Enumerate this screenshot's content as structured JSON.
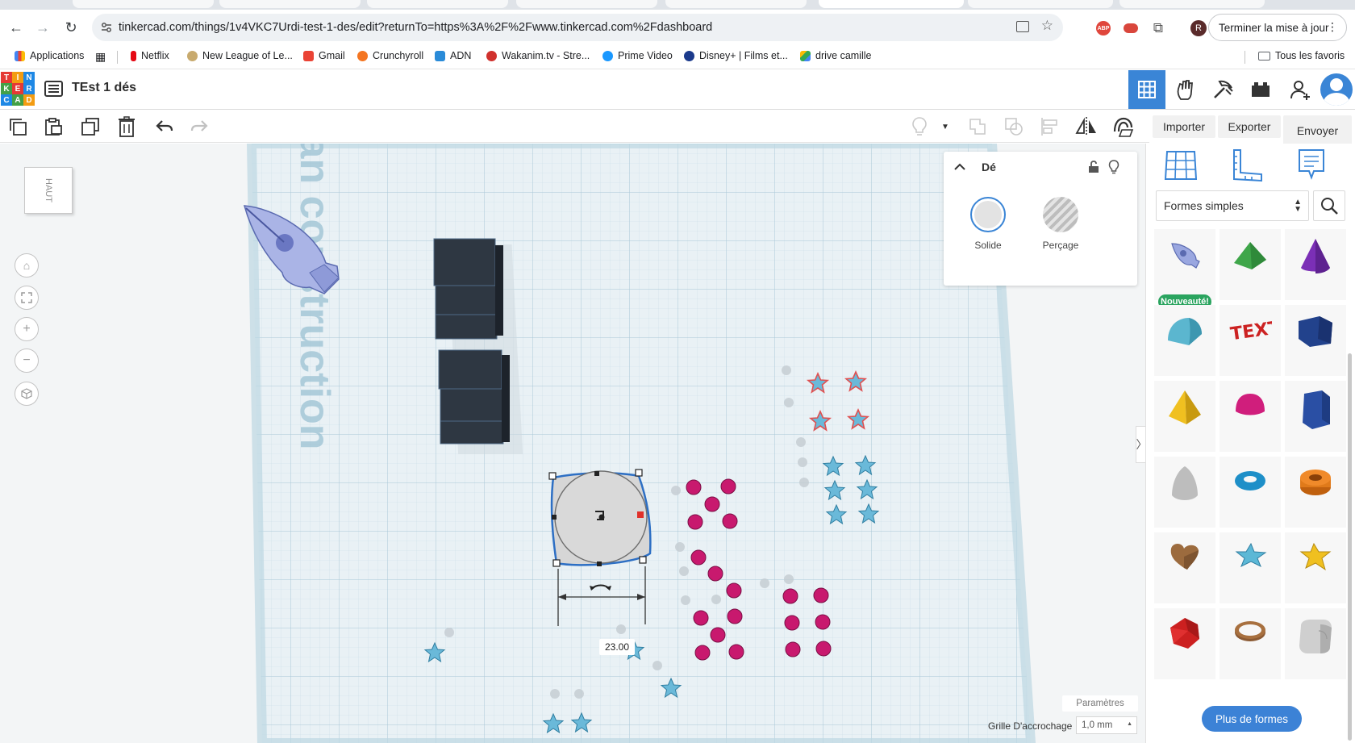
{
  "browser": {
    "url": "tinkercad.com/things/1v4VKC7Urdi-test-1-des/edit?returnTo=https%3A%2F%2Fwww.tinkercad.com%2Fdashboard",
    "update_button": "Terminer la mise à jour",
    "profile_letter": "R",
    "bookmarks": [
      {
        "label": "Applications",
        "color": "#4285f4"
      },
      {
        "label": "Netflix",
        "color": "#e50914"
      },
      {
        "label": "New League of Le...",
        "color": "#c8aa6e"
      },
      {
        "label": "Gmail",
        "color": "#ea4335"
      },
      {
        "label": "Crunchyroll",
        "color": "#f47521"
      },
      {
        "label": "ADN",
        "color": "#2a8bd8"
      },
      {
        "label": "Wakanim.tv - Stre...",
        "color": "#d0312d"
      },
      {
        "label": "Prime Video",
        "color": "#1a98ff"
      },
      {
        "label": "Disney+ | Films et...",
        "color": "#1b3a8c"
      },
      {
        "label": "drive camille",
        "color": "#34a853"
      }
    ],
    "all_bookmarks": "Tous les favoris"
  },
  "app": {
    "logo_letters": [
      "T",
      "I",
      "N",
      "K",
      "E",
      "R",
      "C",
      "A",
      "D"
    ],
    "design_title": "TEst 1 dés",
    "actions": {
      "import": "Importer",
      "export": "Exporter",
      "send": "Envoyer vers"
    }
  },
  "viewcube": {
    "label": "HAUT"
  },
  "workplane": {
    "watermark": "lan construction",
    "dimension_value": "23.00"
  },
  "inspector": {
    "title": "Dé",
    "solid_label": "Solide",
    "hole_label": "Perçage"
  },
  "sidebar": {
    "library": "Formes simples",
    "new_badge": "Nouveauté!",
    "more_shapes": "Plus de formes",
    "shapes": [
      {
        "name": "scribble-shape",
        "color": "#9aa7e0"
      },
      {
        "name": "roof-shape",
        "color": "#3fa64a"
      },
      {
        "name": "cone-shape",
        "color": "#7b2fb6"
      },
      {
        "name": "round-roof-shape",
        "color": "#5bb6cf"
      },
      {
        "name": "text-shape",
        "color": "#cc2222"
      },
      {
        "name": "box-shape",
        "color": "#22428c"
      },
      {
        "name": "pyramid-shape",
        "color": "#f0c020"
      },
      {
        "name": "half-sphere-shape",
        "color": "#d01e7c"
      },
      {
        "name": "polygon-shape",
        "color": "#2a4fa4"
      },
      {
        "name": "paraboloid-shape",
        "color": "#bdbdbd"
      },
      {
        "name": "torus-shape",
        "color": "#1e8fc8"
      },
      {
        "name": "tube-shape",
        "color": "#e07a1a"
      },
      {
        "name": "heart-shape",
        "color": "#9c6b3e"
      },
      {
        "name": "star-shape",
        "color": "#5cb8d6"
      },
      {
        "name": "star-yellow-shape",
        "color": "#f0c020"
      },
      {
        "name": "icosahedron-shape",
        "color": "#cc2020"
      },
      {
        "name": "ring-shape",
        "color": "#8b5a34"
      },
      {
        "name": "rounded-box-shape",
        "color": "#c4c4c4"
      }
    ]
  },
  "footer": {
    "params": "Paramètres",
    "snap_label": "Grille D'accrochage",
    "snap_value": "1,0 mm"
  },
  "colors": {
    "accent": "#3a85d6",
    "grid_bg": "#e9f1f5",
    "dot_magenta": "#c8196e",
    "star_blue": "#6ab9d9",
    "star_red_outline": "#e05050"
  }
}
